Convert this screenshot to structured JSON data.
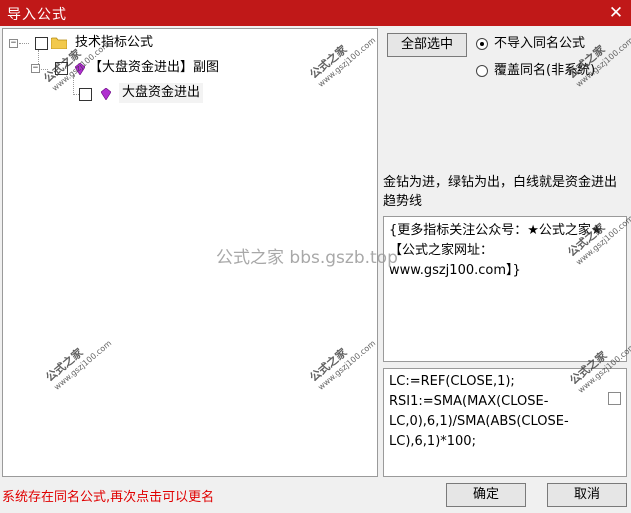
{
  "window": {
    "title": "导入公式",
    "close_glyph": "✕"
  },
  "tree": {
    "root": {
      "expander": "−",
      "label": "技术指标公式"
    },
    "child": {
      "expander": "−",
      "label": "【大盘资金进出】副图"
    },
    "leaf": {
      "label": "大盘资金进出"
    }
  },
  "controls": {
    "select_all": "全部选中",
    "radio_options": [
      {
        "label": "不导入同名公式",
        "selected": true
      },
      {
        "label": "覆盖同名(非系统)",
        "selected": false
      }
    ]
  },
  "description": "金钻为进，绿钻为出，白线就是资金进出趋势线",
  "notes": "{更多指标关注公众号：★公式之家★ 【公式之家网址：www.gszj100.com】}",
  "code": "LC:=REF(CLOSE,1);\nRSI1:=SMA(MAX(CLOSE-LC,0),6,1)/SMA(ABS(CLOSE-LC),6,1)*100;",
  "status": "系统存在同名公式,再次点击可以更名",
  "buttons": {
    "ok": "确定",
    "cancel": "取消"
  },
  "watermark": {
    "brand": "公式之家",
    "url": "www.gszj100.com",
    "center": "公式之家 bbs.gszb.top"
  },
  "colors": {
    "titlebar": "#c01818",
    "status": "#e00000",
    "folder": "#f2c94c",
    "gem": "#b030d0"
  }
}
